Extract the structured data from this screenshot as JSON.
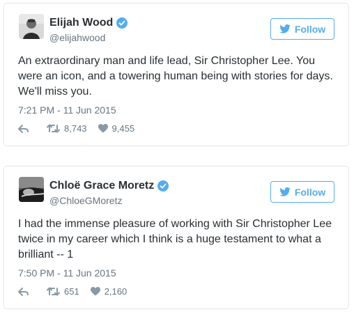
{
  "colors": {
    "accent": "#55acee",
    "muted": "#66757f",
    "text": "#292f33",
    "border": "#e1e8ed"
  },
  "tweets": [
    {
      "name": "Elijah Wood",
      "handle": "@elijahwood",
      "follow_label": "Follow",
      "text": "An extraordinary man and life lead, Sir Christopher Lee. You\nwere an icon, and a towering human being with stories for days.\nWe'll miss you.",
      "timestamp": "7:21 PM - 11 Jun 2015",
      "retweets": "8,743",
      "likes": "9,455",
      "icons": [
        "verified-icon",
        "twitter-bird-icon",
        "reply-icon",
        "retweet-icon",
        "heart-icon"
      ]
    },
    {
      "name": "Chloë Grace Moretz",
      "handle": "@ChloeGMoretz",
      "follow_label": "Follow",
      "text": "I had the immense pleasure of working with Sir Christopher Lee\ntwice in my career which I think is a huge testament to what a\nbrilliant -- 1",
      "timestamp": "7:50 PM - 11 Jun 2015",
      "retweets": "651",
      "likes": "2,160",
      "icons": [
        "verified-icon",
        "twitter-bird-icon",
        "reply-icon",
        "retweet-icon",
        "heart-icon"
      ]
    }
  ]
}
